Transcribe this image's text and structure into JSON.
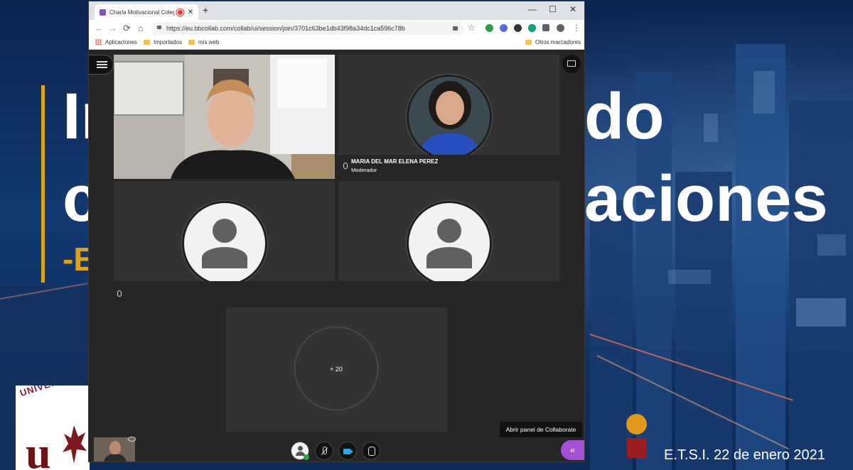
{
  "slide": {
    "line1_left": "In",
    "line1_right": "do",
    "line2_left": "c",
    "line2_right": "aciones",
    "line3_left": "-E",
    "footer": "E.T.S.I. 22 de enero 2021",
    "logo_text": "UNIVERSIDAD",
    "logo_mark": "u",
    "colors": {
      "gold": "#e0a21b",
      "red": "#9c1d1f"
    }
  },
  "browser": {
    "tab_title": "Charla Motivacional Colegio",
    "tab_close": "✕",
    "new_tab": "+",
    "window_controls": {
      "minimize": "—",
      "maximize": "☐",
      "close": "✕"
    },
    "url": "https://eu.bbcollab.com/collab/ui/session/join/3701c63be1db43f98a34dc1ca596c78b",
    "nav": {
      "back": "←",
      "forward": "→",
      "reload": "⟳",
      "home": "⌂"
    },
    "menu": "⋮",
    "star": "☆",
    "bookmarks": [
      {
        "label": "Aplicaciones"
      },
      {
        "label": "Importados"
      },
      {
        "label": "mis web"
      }
    ],
    "other_bookmarks": "Otros marcadores"
  },
  "collaborate": {
    "participants": [
      {
        "id": "presenter-video",
        "name": "",
        "role": ""
      },
      {
        "id": "moderator",
        "name": "MARIA DEL MAR ELENA PEREZ",
        "role": "Moderador"
      },
      {
        "id": "attendee-1",
        "name": "",
        "role": ""
      },
      {
        "id": "attendee-2",
        "name": "",
        "role": ""
      }
    ],
    "overflow_count": "+ 20",
    "tooltip": "Abrir panel de Collaborate",
    "open_panel_icon": "«",
    "accent": "#a34fd6"
  }
}
